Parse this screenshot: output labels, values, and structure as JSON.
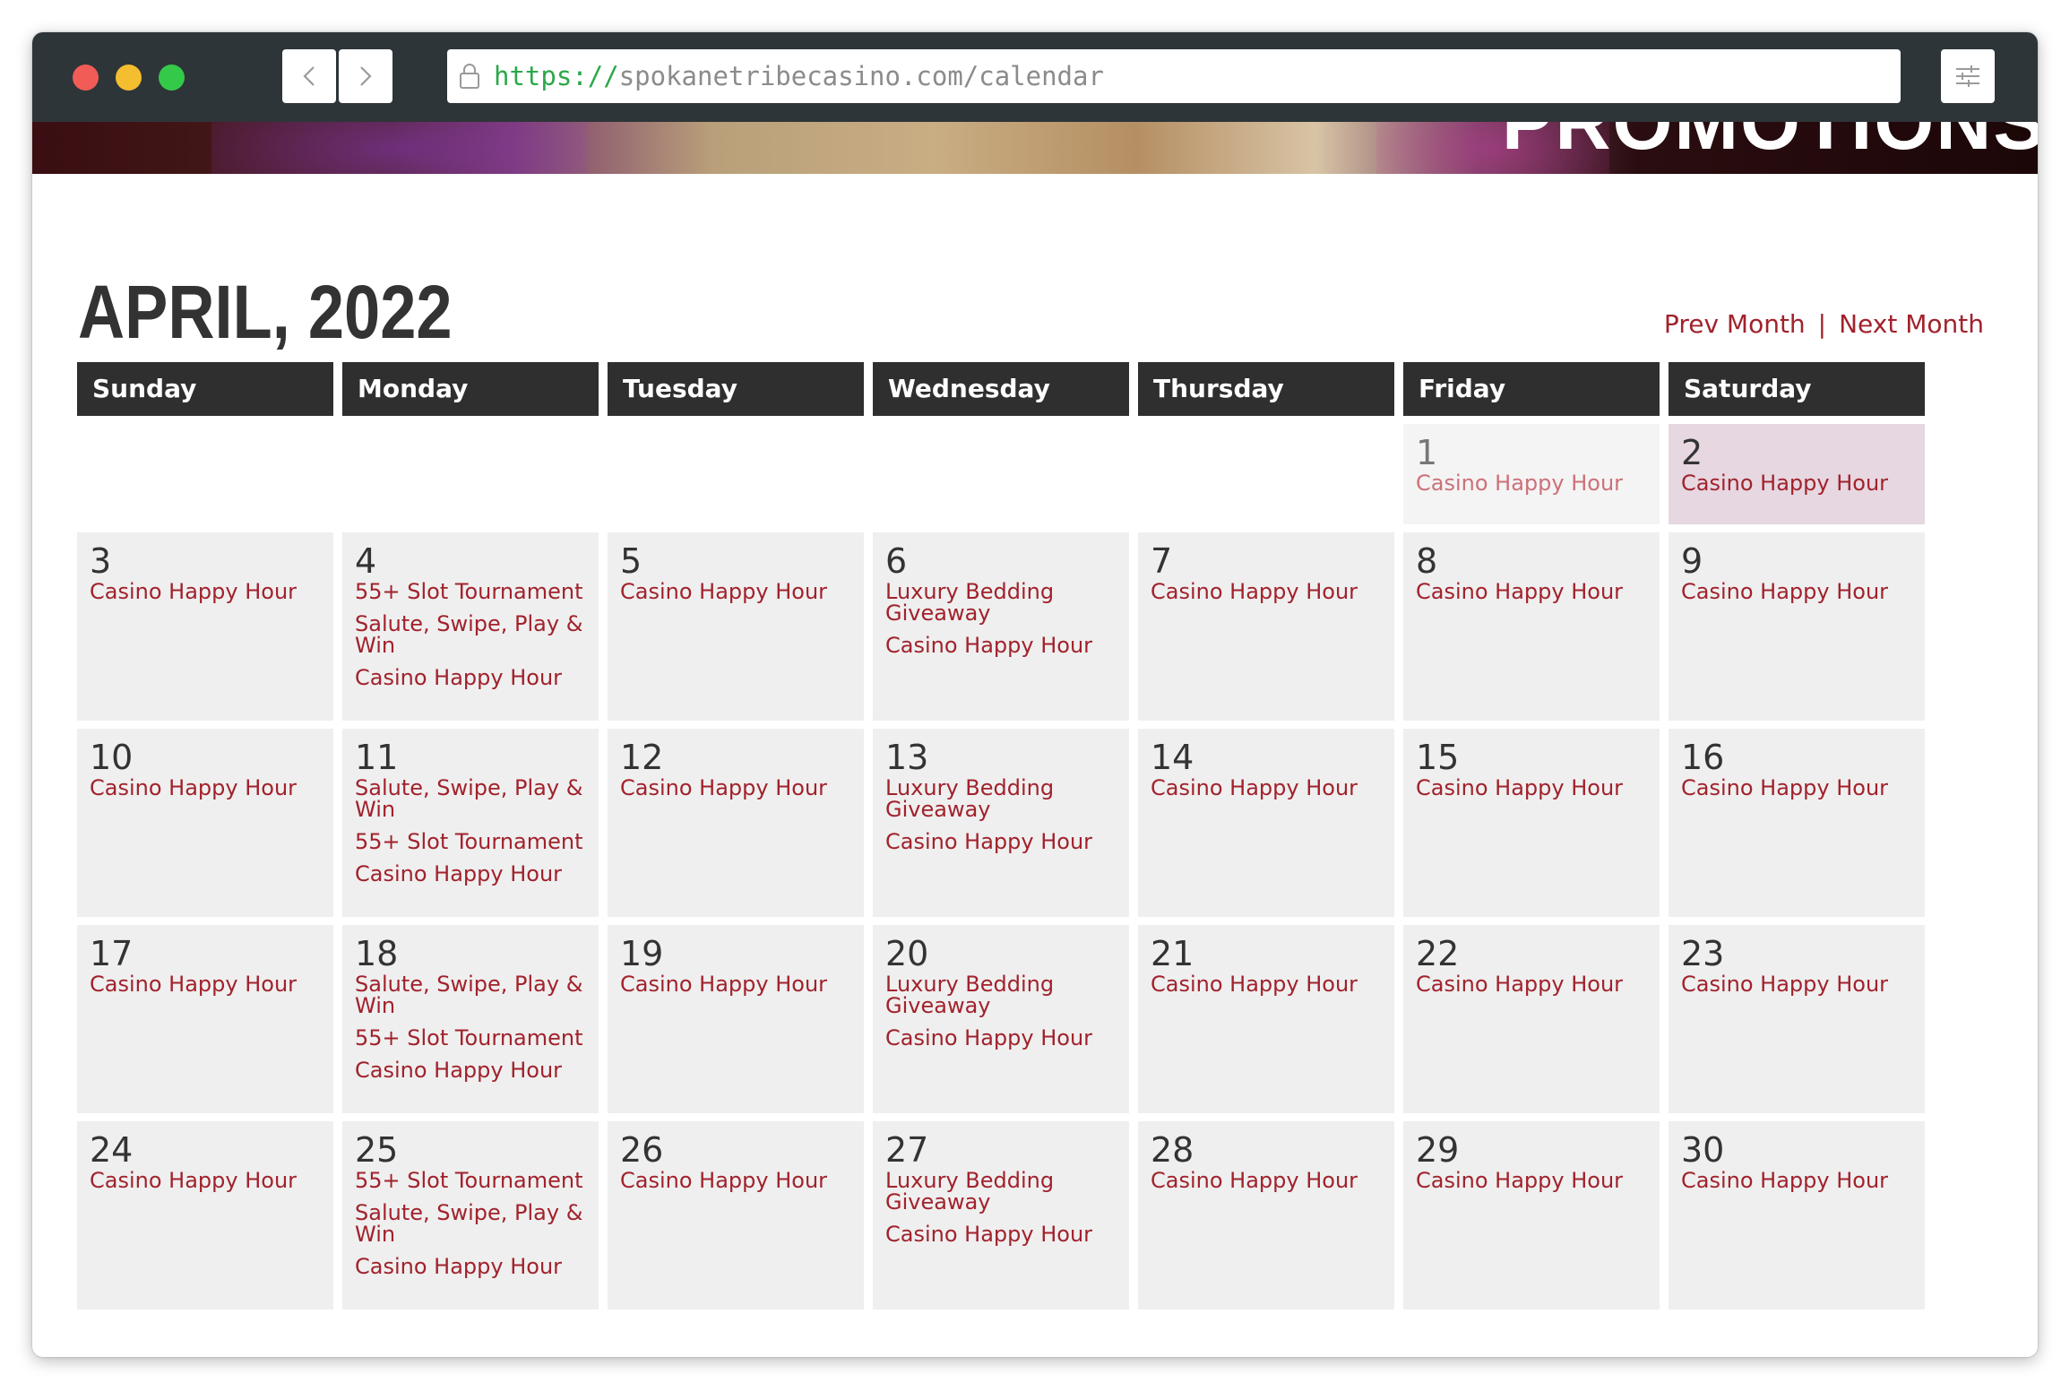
{
  "browser": {
    "url_scheme": "https://",
    "url_rest": "spokanetribecasino.com/calendar"
  },
  "hero": {
    "partial_text": "PROMOTIONS"
  },
  "calendar": {
    "title": "APRIL, 2022",
    "prev_label": "Prev Month",
    "separator": "|",
    "next_label": "Next Month",
    "days": [
      "Sunday",
      "Monday",
      "Tuesday",
      "Wednesday",
      "Thursday",
      "Friday",
      "Saturday"
    ],
    "cells": [
      {
        "day": "",
        "events": []
      },
      {
        "day": "",
        "events": []
      },
      {
        "day": "",
        "events": []
      },
      {
        "day": "",
        "events": []
      },
      {
        "day": "",
        "events": []
      },
      {
        "day": "1",
        "state": "past",
        "events": [
          "Casino Happy Hour"
        ]
      },
      {
        "day": "2",
        "state": "today",
        "events": [
          "Casino Happy Hour"
        ]
      },
      {
        "day": "3",
        "events": [
          "Casino Happy Hour"
        ]
      },
      {
        "day": "4",
        "events": [
          "55+ Slot Tournament",
          "Salute, Swipe, Play & Win",
          "Casino Happy Hour"
        ]
      },
      {
        "day": "5",
        "events": [
          "Casino Happy Hour"
        ]
      },
      {
        "day": "6",
        "events": [
          "Luxury Bedding Giveaway",
          "Casino Happy Hour"
        ]
      },
      {
        "day": "7",
        "events": [
          "Casino Happy Hour"
        ]
      },
      {
        "day": "8",
        "events": [
          "Casino Happy Hour"
        ]
      },
      {
        "day": "9",
        "events": [
          "Casino Happy Hour"
        ]
      },
      {
        "day": "10",
        "events": [
          "Casino Happy Hour"
        ]
      },
      {
        "day": "11",
        "events": [
          "Salute, Swipe, Play & Win",
          "55+ Slot Tournament",
          "Casino Happy Hour"
        ]
      },
      {
        "day": "12",
        "events": [
          "Casino Happy Hour"
        ]
      },
      {
        "day": "13",
        "events": [
          "Luxury Bedding Giveaway",
          "Casino Happy Hour"
        ]
      },
      {
        "day": "14",
        "events": [
          "Casino Happy Hour"
        ]
      },
      {
        "day": "15",
        "events": [
          "Casino Happy Hour"
        ]
      },
      {
        "day": "16",
        "events": [
          "Casino Happy Hour"
        ]
      },
      {
        "day": "17",
        "events": [
          "Casino Happy Hour"
        ]
      },
      {
        "day": "18",
        "events": [
          "Salute, Swipe, Play & Win",
          "55+ Slot Tournament",
          "Casino Happy Hour"
        ]
      },
      {
        "day": "19",
        "events": [
          "Casino Happy Hour"
        ]
      },
      {
        "day": "20",
        "events": [
          "Luxury Bedding Giveaway",
          "Casino Happy Hour"
        ]
      },
      {
        "day": "21",
        "events": [
          "Casino Happy Hour"
        ]
      },
      {
        "day": "22",
        "events": [
          "Casino Happy Hour"
        ]
      },
      {
        "day": "23",
        "events": [
          "Casino Happy Hour"
        ]
      },
      {
        "day": "24",
        "events": [
          "Casino Happy Hour"
        ]
      },
      {
        "day": "25",
        "events": [
          "55+ Slot Tournament",
          "Salute, Swipe, Play & Win",
          "Casino Happy Hour"
        ]
      },
      {
        "day": "26",
        "events": [
          "Casino Happy Hour"
        ]
      },
      {
        "day": "27",
        "events": [
          "Luxury Bedding Giveaway",
          "Casino Happy Hour"
        ]
      },
      {
        "day": "28",
        "events": [
          "Casino Happy Hour"
        ]
      },
      {
        "day": "29",
        "events": [
          "Casino Happy Hour"
        ]
      },
      {
        "day": "30",
        "events": [
          "Casino Happy Hour"
        ]
      }
    ]
  },
  "colors": {
    "accent": "#a1222c",
    "header_bg": "#2f2f2f",
    "cell_bg": "#efefef",
    "today_bg": "#e6d7e1"
  },
  "icons": {
    "back": "chevron-left-icon",
    "forward": "chevron-right-icon",
    "lock": "lock-icon",
    "menu": "sliders-icon"
  }
}
